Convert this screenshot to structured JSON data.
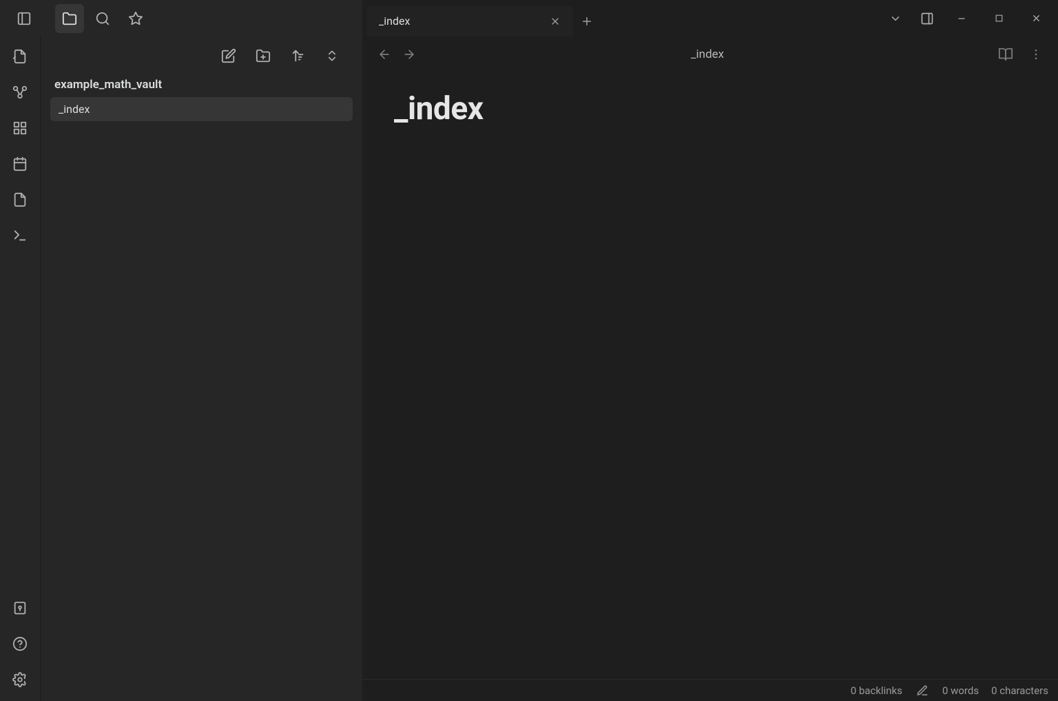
{
  "titlebar": {
    "tabs": [
      {
        "title": "_index"
      }
    ]
  },
  "vault": {
    "name": "example_math_vault",
    "files": [
      {
        "name": "_index",
        "active": true
      }
    ]
  },
  "editor": {
    "breadcrumb": "_index",
    "note_title": "_index"
  },
  "statusbar": {
    "backlinks": "0 backlinks",
    "words": "0 words",
    "characters": "0 characters"
  }
}
